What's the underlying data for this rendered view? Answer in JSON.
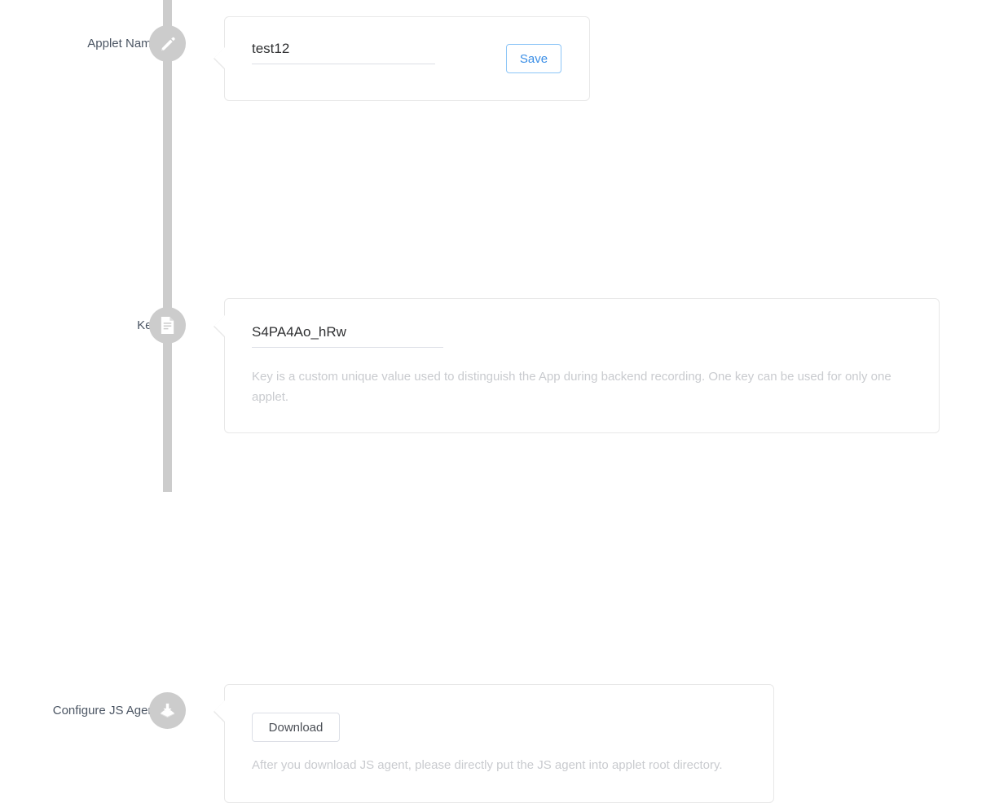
{
  "colors": {
    "timeline": "#cccccc",
    "card_border": "#e8e8e8",
    "primary": "#3a8ee6",
    "primary_border": "#8cc5f7",
    "hint_text": "#c9cbcf",
    "label_text": "#4b5563",
    "input_underline": "#dcdfe6"
  },
  "steps": [
    {
      "key": "applet_name",
      "label": "Applet Name",
      "icon": "pencil-icon",
      "input": {
        "value": "test12",
        "placeholder": ""
      },
      "button": {
        "label": "Save",
        "style": "primary-outline"
      }
    },
    {
      "key": "key",
      "label": "Key",
      "icon": "document-icon",
      "input": {
        "value": "S4PA4Ao_hRw",
        "placeholder": ""
      },
      "hint": "Key is a custom unique value used to distinguish the App during backend recording. One key can be used for only one applet."
    },
    {
      "key": "js_agent",
      "label": "Configure JS Agent",
      "icon": "download-icon",
      "button": {
        "label": "Download",
        "style": "default"
      },
      "hint": "After you download JS agent, please directly put the JS agent into applet root directory."
    }
  ]
}
